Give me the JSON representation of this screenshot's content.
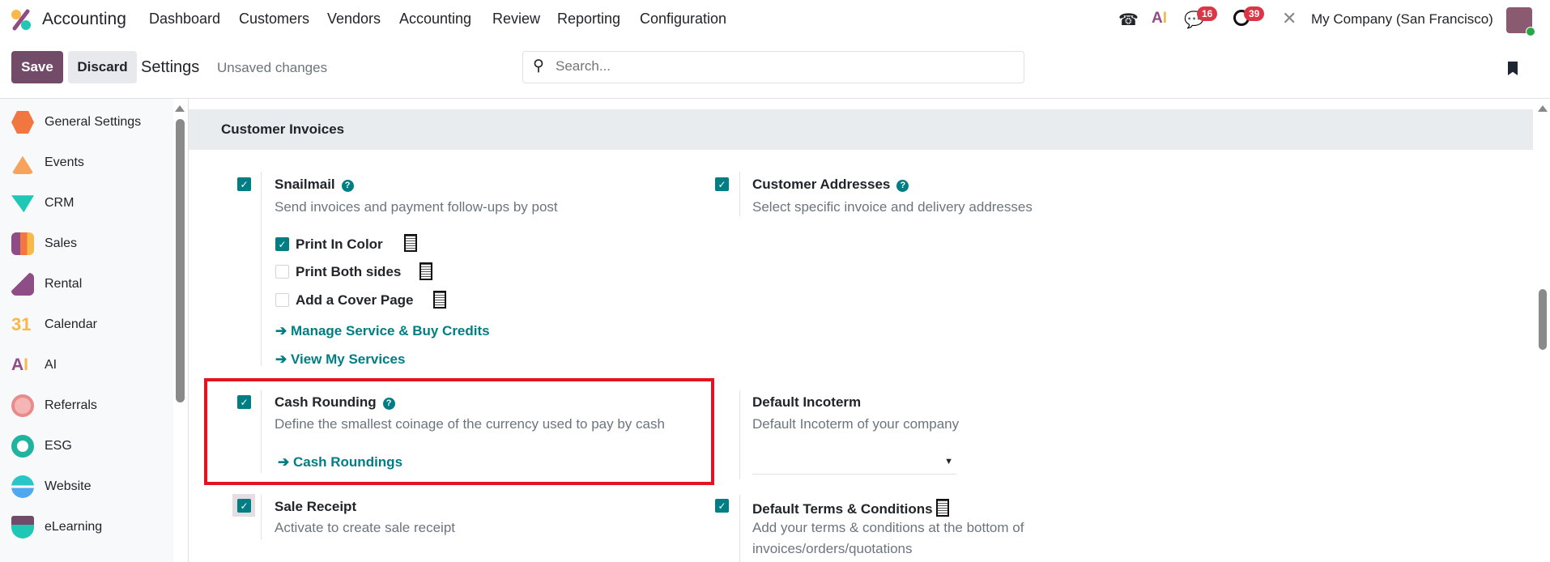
{
  "app": {
    "name": "Accounting"
  },
  "menu": [
    "Dashboard",
    "Customers",
    "Vendors",
    "Accounting",
    "Review",
    "Reporting",
    "Configuration"
  ],
  "systray": {
    "messages_count": "16",
    "activities_count": "39",
    "company": "My Company (San Francisco)"
  },
  "control": {
    "save": "Save",
    "discard": "Discard",
    "breadcrumb": "Settings",
    "status": "Unsaved changes",
    "search_placeholder": "Search..."
  },
  "sidebar": [
    {
      "label": "General Settings",
      "color": "#d2691e"
    },
    {
      "label": "Events",
      "color": "#f7a35c"
    },
    {
      "label": "CRM",
      "color": "#1fc8b4"
    },
    {
      "label": "Sales",
      "color": "#f27640"
    },
    {
      "label": "Rental",
      "color": "#8e4d86"
    },
    {
      "label": "Calendar",
      "color": "#f8b84a"
    },
    {
      "label": "AI",
      "color": "#8e4d86"
    },
    {
      "label": "Referrals",
      "color": "#e88b8b"
    },
    {
      "label": "ESG",
      "color": "#1fb3a0"
    },
    {
      "label": "Website",
      "color": "#2bc4c7"
    },
    {
      "label": "eLearning",
      "color": "#714b67"
    }
  ],
  "section": {
    "title": "Customer Invoices"
  },
  "settings": {
    "snailmail": {
      "title": "Snailmail",
      "desc": "Send invoices and payment follow-ups by post",
      "checked": true,
      "options": [
        {
          "label": "Print In Color",
          "checked": true
        },
        {
          "label": "Print Both sides",
          "checked": false
        },
        {
          "label": "Add a Cover Page",
          "checked": false
        }
      ],
      "links": [
        "Manage Service & Buy Credits",
        "View My Services"
      ]
    },
    "customer_addresses": {
      "title": "Customer Addresses",
      "desc": "Select specific invoice and delivery addresses",
      "checked": true
    },
    "cash_rounding": {
      "title": "Cash Rounding",
      "desc": "Define the smallest coinage of the currency used to pay by cash",
      "link": "Cash Roundings",
      "checked": true
    },
    "default_incoterm": {
      "title": "Default Incoterm",
      "desc": "Default Incoterm of your company",
      "value": ""
    },
    "sale_receipt": {
      "title": "Sale Receipt",
      "desc": "Activate to create sale receipt",
      "checked": true
    },
    "default_terms": {
      "title": "Default Terms & Conditions",
      "desc1": "Add your terms & conditions at the bottom of",
      "desc2": "invoices/orders/quotations",
      "checked": true
    }
  },
  "colors": {
    "primary": "#714b67",
    "teal": "#017e84",
    "highlight": "#e3141f"
  }
}
